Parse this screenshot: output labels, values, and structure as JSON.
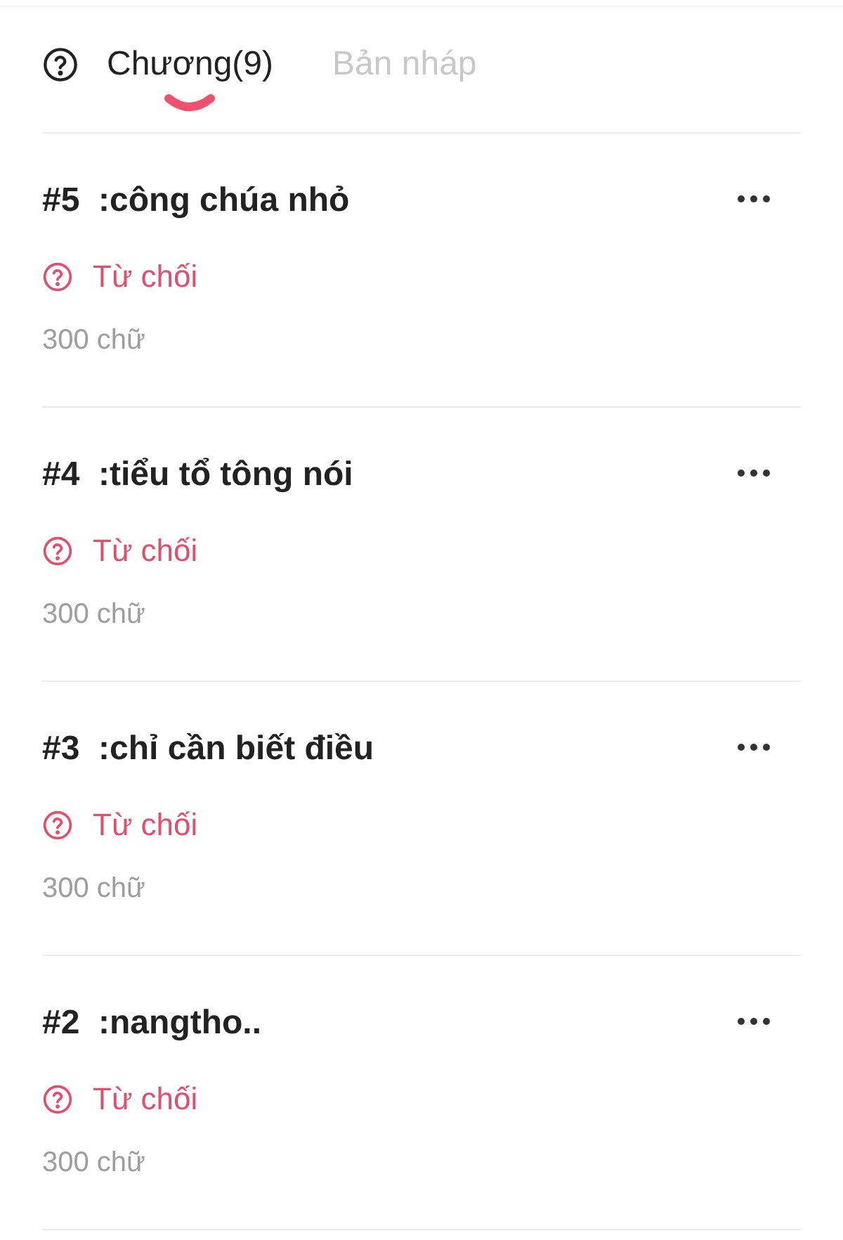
{
  "tabs": [
    {
      "label": "Chương(9)",
      "selected": true
    },
    {
      "label": "Bản nháp",
      "selected": false
    }
  ],
  "chapters": [
    {
      "title": "#5  :công chúa nhỏ",
      "status": "Từ chối",
      "words": "300 chữ"
    },
    {
      "title": "#4  :tiểu tổ tông nói",
      "status": "Từ chối",
      "words": "300 chữ"
    },
    {
      "title": "#3  :chỉ cần biết điều",
      "status": "Từ chối",
      "words": "300 chữ"
    },
    {
      "title": "#2  :nangtho..",
      "status": "Từ chối",
      "words": "300 chữ"
    }
  ]
}
